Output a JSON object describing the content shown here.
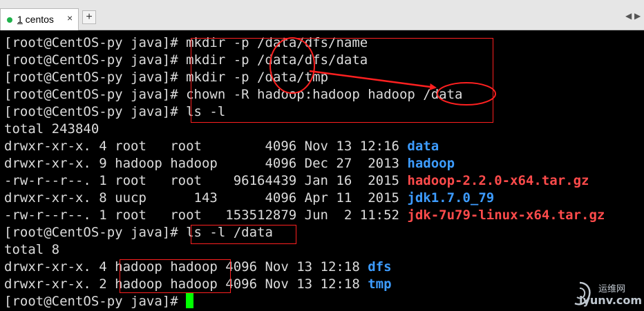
{
  "tabbar": {
    "tab_number": "1",
    "tab_name": " centos",
    "close_glyph": "×",
    "new_tab_glyph": "+",
    "prev_glyph": "◀",
    "next_glyph": "▶",
    "status_color": "#1fb24b"
  },
  "terminal": {
    "prompt": "[root@CentOS-py java]# ",
    "cmd1": "mkdir -p /data/dfs/name",
    "cmd2": "mkdir -p /data/dfs/data",
    "cmd3": "mkdir -p /data/tmp",
    "cmd4": "chown -R hadoop:hadoop hadoop /data",
    "cmd5": "ls -l",
    "total1": "total 243840",
    "ls_rows": [
      {
        "meta": "drwxr-xr-x. 4 root   root        4096 Nov 13 12:16 ",
        "name": "data"
      },
      {
        "meta": "drwxr-xr-x. 9 hadoop hadoop      4096 Dec 27  2013 ",
        "name": "hadoop"
      },
      {
        "meta": "-rw-r--r--. 1 root   root    96164439 Jan 16  2015 ",
        "name": "hadoop-2.2.0-x64.tar.gz"
      },
      {
        "meta": "drwxr-xr-x. 8 uucp      143      4096 Apr 11  2015 ",
        "name": "jdk1.7.0_79"
      },
      {
        "meta": "-rw-r--r--. 1 root   root   153512879 Jun  2 11:52 ",
        "name": "jdk-7u79-linux-x64.tar.gz"
      }
    ],
    "cmd6": "ls -l /data",
    "total2": "total 8",
    "data_rows": [
      {
        "meta": "drwxr-xr-x. 4 hadoop hadoop 4096 Nov 13 12:18 ",
        "name": "dfs"
      },
      {
        "meta": "drwxr-xr-x. 2 hadoop hadoop 4096 Nov 13 12:18 ",
        "name": "tmp"
      }
    ]
  },
  "watermark": {
    "site_cn": "运维网",
    "site_url": "iyunv.com"
  },
  "colors": {
    "background": "#000000",
    "text": "#dcdcdc",
    "directory": "#3d9cff",
    "archive": "#ff4b4b",
    "annotation": "#ff2020",
    "cursor": "#00ff00"
  }
}
